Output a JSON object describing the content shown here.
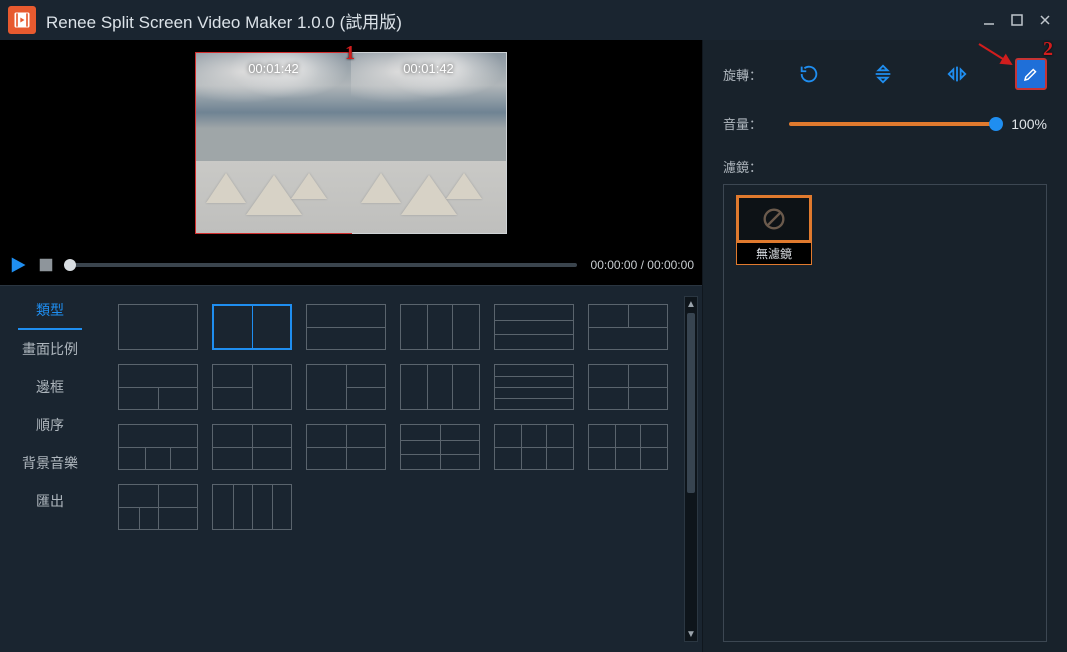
{
  "app": {
    "title": "Renee Split Screen Video Maker 1.0.0 (試用版)"
  },
  "preview": {
    "clips": [
      {
        "time": "00:01:42",
        "selected": true
      },
      {
        "time": "00:01:42",
        "selected": false
      }
    ]
  },
  "playback": {
    "current": "00:00:00",
    "total": "00:00:00"
  },
  "side_tabs": [
    {
      "label": "類型",
      "active": true
    },
    {
      "label": "畫面比例",
      "active": false
    },
    {
      "label": "邊框",
      "active": false
    },
    {
      "label": "順序",
      "active": false
    },
    {
      "label": "背景音樂",
      "active": false
    },
    {
      "label": "匯出",
      "active": false
    }
  ],
  "layout_templates": {
    "selected_index": 1,
    "count": 20
  },
  "right_panel": {
    "rotate_label": "旋轉：",
    "volume_label": "音量：",
    "volume_value": "100%",
    "filter_label": "濾鏡：",
    "filters": [
      {
        "name": "無濾鏡",
        "selected": true
      }
    ]
  },
  "annotations": {
    "a1": "1",
    "a2": "2"
  }
}
